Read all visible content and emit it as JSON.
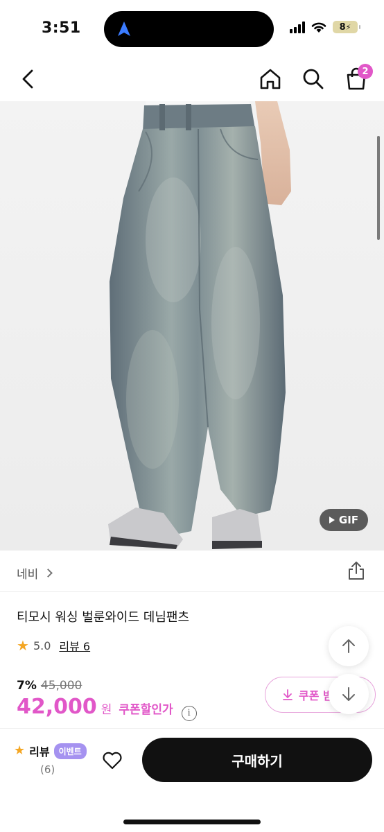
{
  "status_bar": {
    "time": "3:51",
    "battery": "8"
  },
  "nav": {
    "cart_count": "2"
  },
  "product_image": {
    "gif_label": "GIF"
  },
  "product": {
    "color_label": "네비",
    "title": "티모시 워싱 벌룬와이드 데님팬츠",
    "rating": "5.0",
    "review_label": "리뷰 6",
    "discount_rate": "7%",
    "original_price": "45,000",
    "price": "42,000",
    "price_unit": "원",
    "coupon_price_label": "쿠폰할인가",
    "info_symbol": "i",
    "coupon_button_label": "쿠폰 받"
  },
  "bottom_bar": {
    "review_label": "리뷰",
    "event_badge": "이벤트",
    "review_count": "(6)",
    "buy_label": "구매하기"
  },
  "colors": {
    "accent": "#e157c8",
    "star": "#f4a623",
    "event": "#a592f0"
  }
}
